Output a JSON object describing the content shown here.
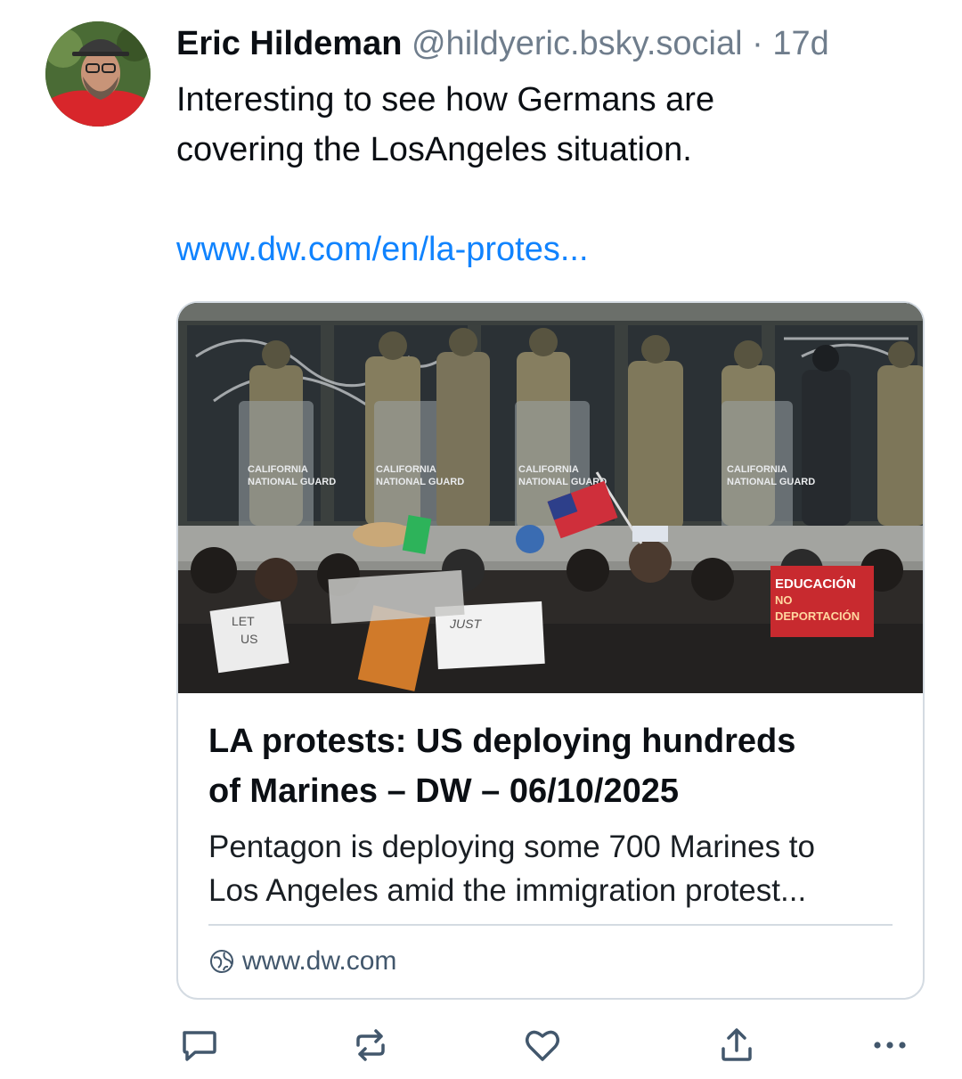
{
  "author": {
    "display_name": "Eric Hildeman",
    "handle": "@hildyeric.bsky.social",
    "separator": "·",
    "age": "17d",
    "avatar_icon": "user-avatar"
  },
  "post": {
    "text_line1": "Interesting to see how Germans are",
    "text_line2": "covering the LosAngeles situation.",
    "link": "www.dw.com/en/la-protes..."
  },
  "embed": {
    "image_icon": "protest-photo",
    "image_sign_texts": [
      "CALIFORNIA",
      "NATIONAL GUARD",
      "EDUCACIÓN",
      "NO",
      "DEPORTACIÓN",
      "LET",
      "US",
      "JUST"
    ],
    "title_line1": "LA protests: US deploying hundreds",
    "title_line2": "of Marines  – DW – 06/10/2025",
    "desc_line1": "Pentagon is deploying some 700 Marines to",
    "desc_line2": "Los Angeles amid the immigration protest...",
    "domain": "www.dw.com",
    "domain_icon": "globe-icon"
  },
  "actions": {
    "reply_icon": "reply-icon",
    "repost_icon": "repost-icon",
    "like_icon": "heart-icon",
    "share_icon": "share-icon",
    "more_icon": "more-icon"
  },
  "colors": {
    "link": "#1083fe",
    "muted": "#6f7d8c",
    "border": "#d4dbe2",
    "icon": "#42576c"
  }
}
